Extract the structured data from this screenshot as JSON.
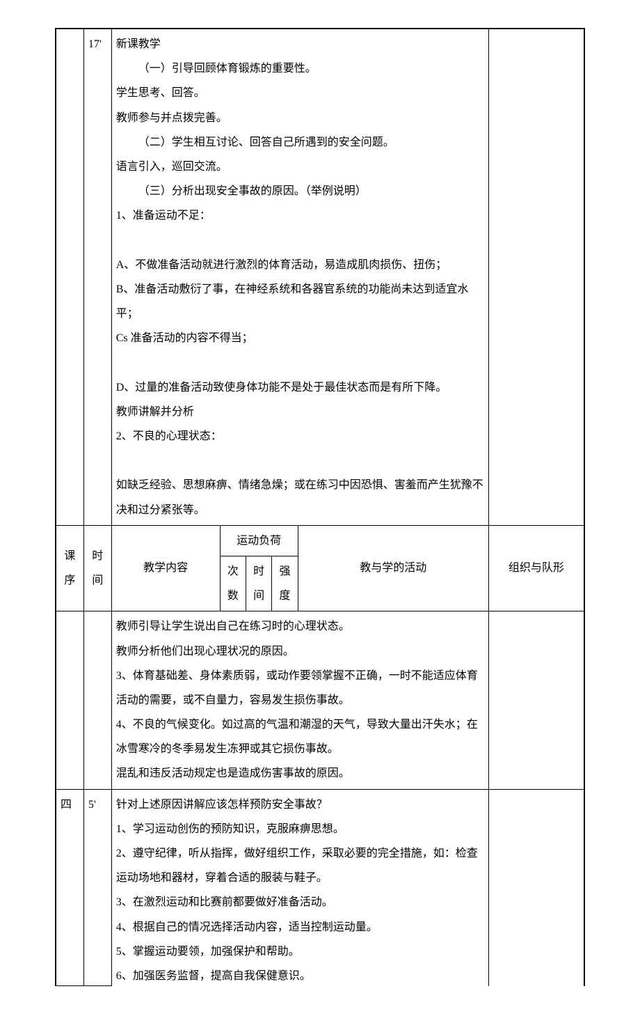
{
  "row1": {
    "seq": "",
    "time": "17'",
    "content": {
      "title": "新课教学",
      "p1": "（一）引导回顾体育锻炼的重要性。",
      "p2": "学生思考、回答。",
      "p3": "教师参与并点拨完善。",
      "p4": "（二）学生相互讨论、回答自己所遇到的安全问题。",
      "p5": "语言引入，巡回交流。",
      "p6": "（三）分析出现安全事故的原因。（举例说明）",
      "p7": "1、准备运动不足：",
      "p8": "A、不做准备活动就进行激烈的体育活动，易造成肌肉损伤、扭伤；",
      "p9": "B、准备活动敷衍了事，在神经系统和各器官系统的功能尚未达到适宜水平；",
      "p10": "Cs 准备活动的内容不得当；",
      "p11": "D、过量的准备活动致使身体功能不是处于最佳状态而是有所下降。",
      "p12": "教师讲解并分析",
      "p13": "2、不良的心理状态：",
      "p14": "如缺乏经验、思想麻痹、情绪急燥；或在练习中因恐惧、害羞而产生犹豫不决和过分紧张等。"
    },
    "org": ""
  },
  "header": {
    "seq": "课序",
    "time": "时间",
    "content": "教学内容",
    "load": "运动负荷",
    "sub1": "次",
    "sub2": "时",
    "sub3": "强",
    "sub4": "数",
    "sub5": "间",
    "sub6": "度",
    "activity": "教与学的活动",
    "org": "组织与队形"
  },
  "row2": {
    "seq": "",
    "time": "",
    "content": {
      "p1": "教师引导让学生说出自己在练习时的心理状态。",
      "p2": "教师分析他们出现心理状况的原因。",
      "p3": "3、体育基础差、身体素质弱，或动作要领掌握不正确，一时不能适应体育活动的需要，或不自量力，容易发生损伤事故。",
      "p4": "4、不良的气候变化。如过高的气温和潮湿的天气，导致大量出汗失水；在冰雪寒冷的冬季易发生冻狎或其它损伤事故。",
      "p5": "混乱和违反活动规定也是造成伤害事故的原因。"
    },
    "org": ""
  },
  "row3": {
    "seq": "四",
    "time": "5'",
    "content": {
      "p1": "针对上述原因讲解应该怎样预防安全事故？",
      "p2": "1、学习运动创伤的预防知识，克服麻痹思想。",
      "p3": "2、遵守纪律，听从指挥，做好组织工作，采取必要的完全措施，如：检查运动场地和器材，穿着合适的服装与鞋子。",
      "p4": "3、在激烈运动和比赛前都要做好准备活动。",
      "p5": "4、根据自己的情况选择活动内容，适当控制运动量。",
      "p6": "5、掌握运动要领，加强保护和帮助。",
      "p7": "6、加强医务监督，提高自我保健意识。"
    },
    "org": ""
  }
}
